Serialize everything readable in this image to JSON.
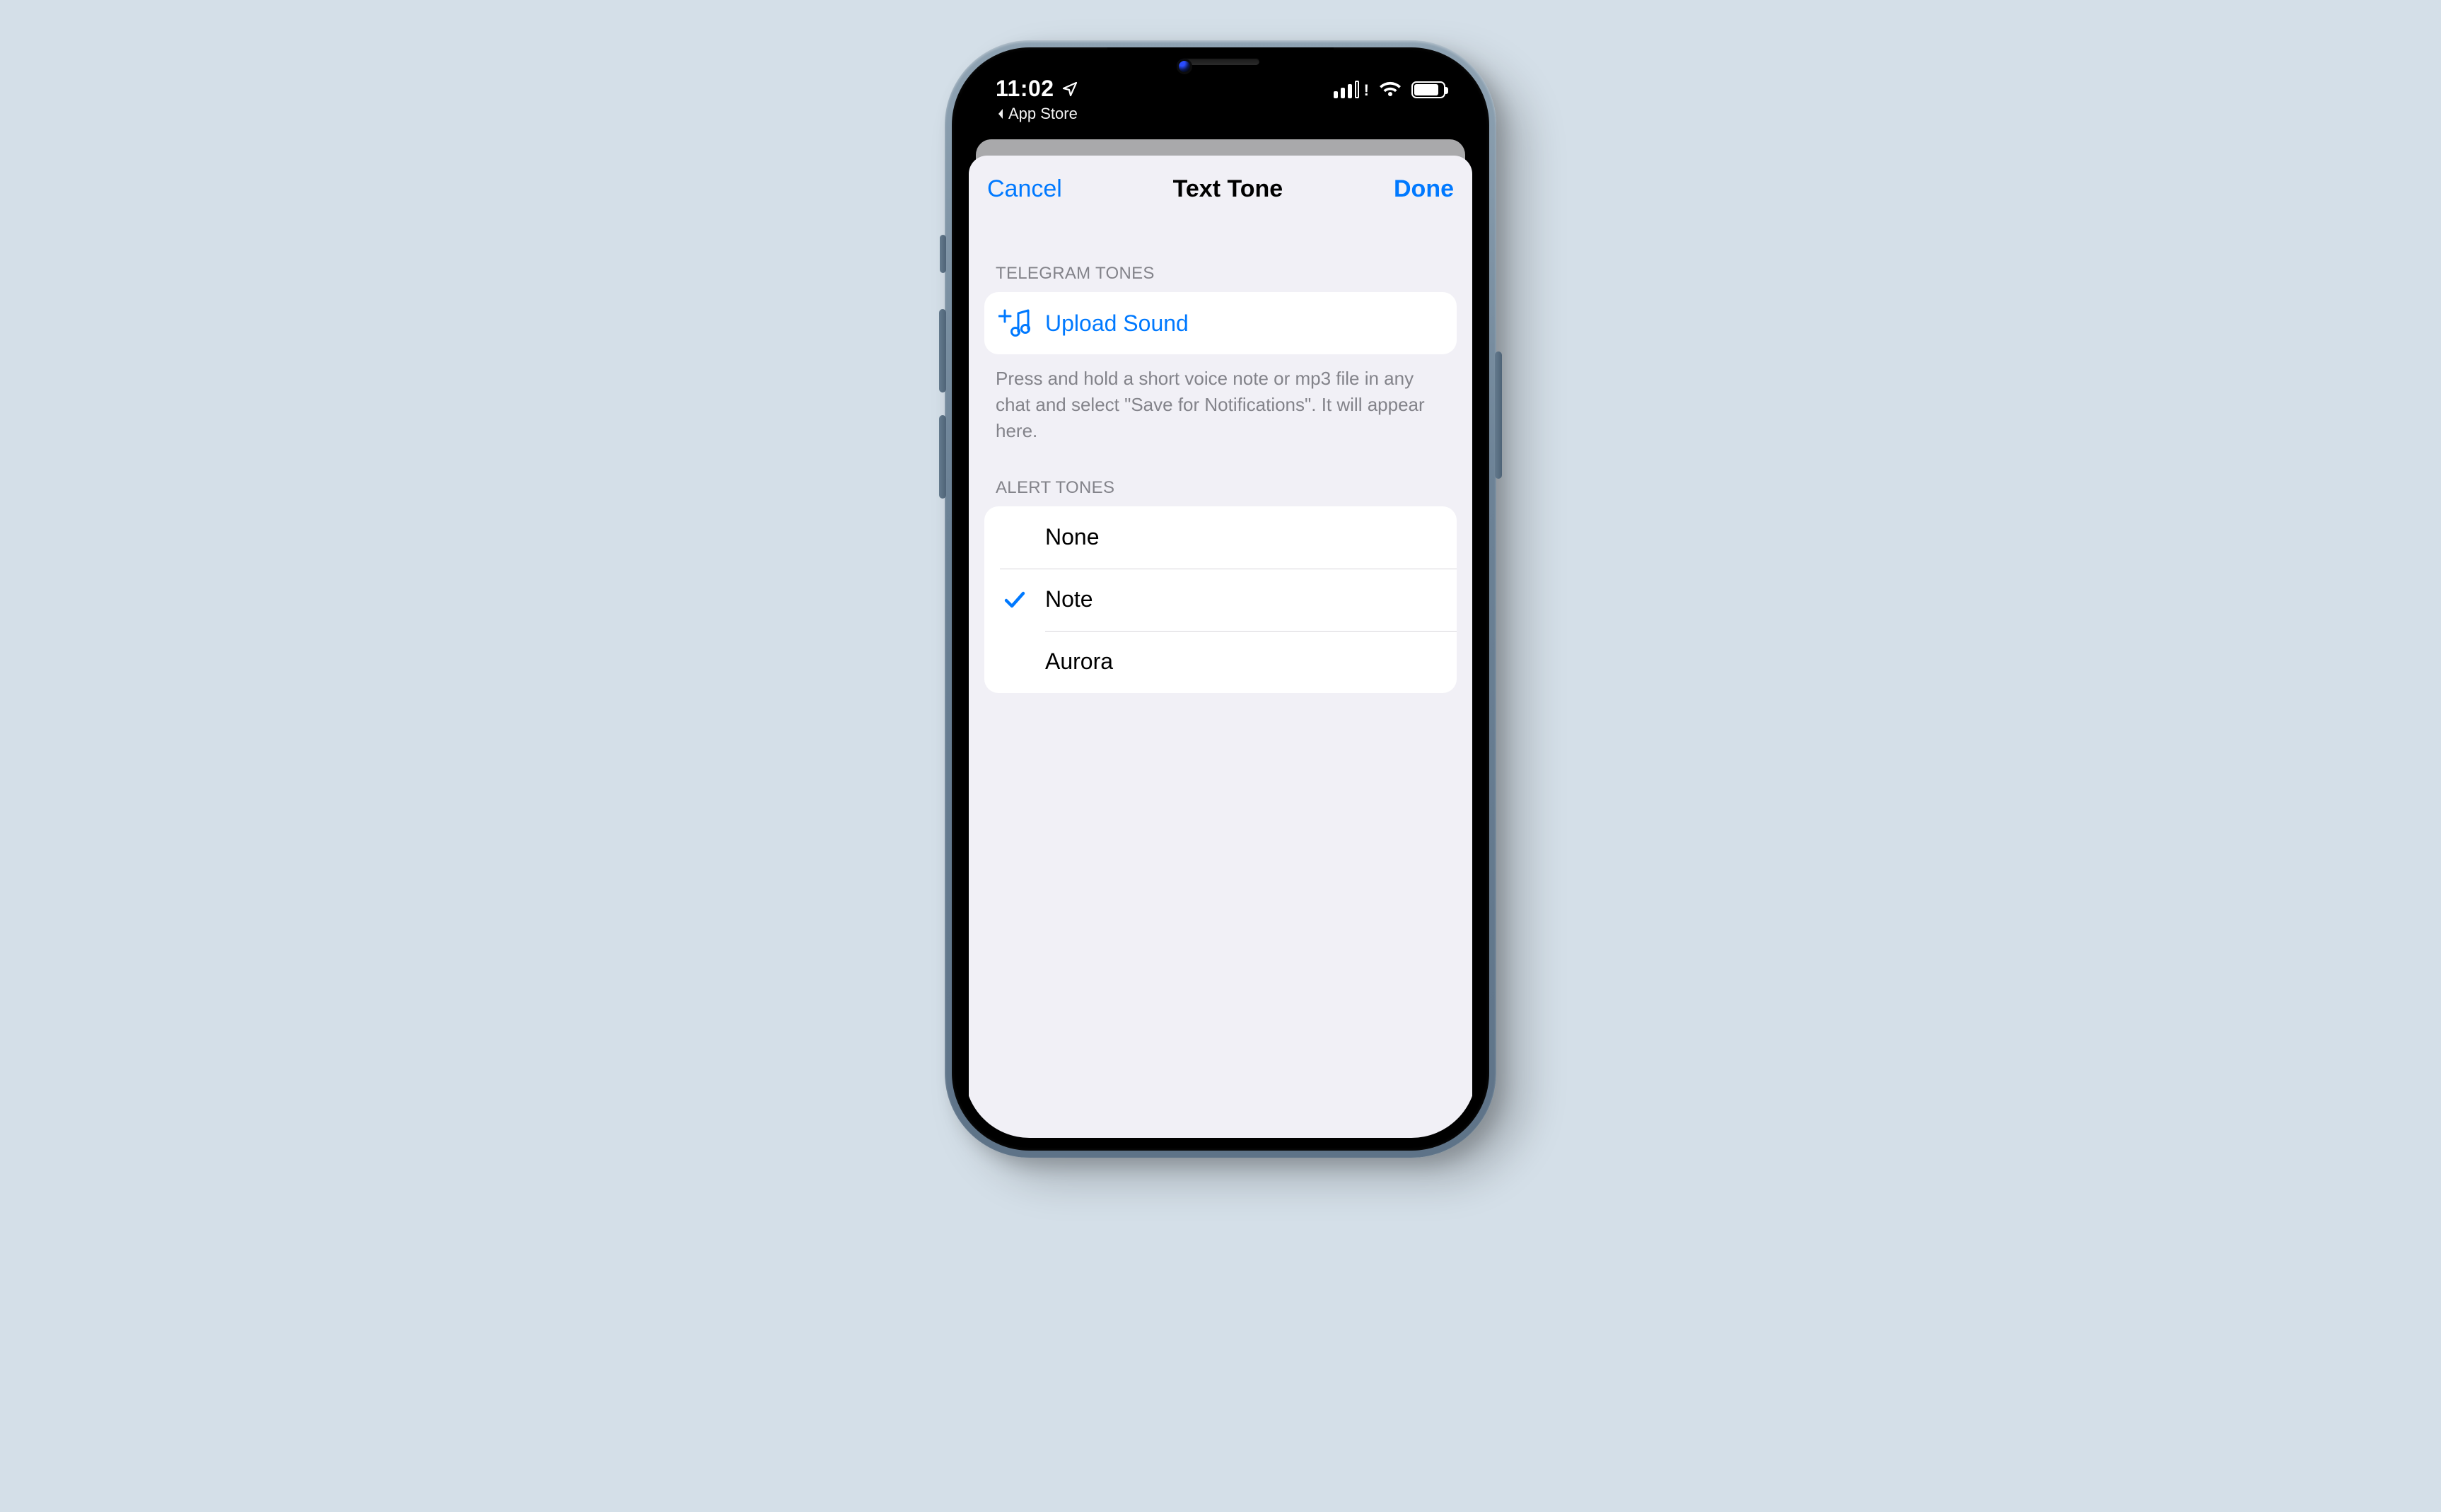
{
  "statusbar": {
    "time": "11:02",
    "back_app": "App Store"
  },
  "nav": {
    "cancel": "Cancel",
    "title": "Text Tone",
    "done": "Done"
  },
  "telegram_section": {
    "header": "TELEGRAM TONES",
    "upload_label": "Upload Sound",
    "footer": "Press and hold a short voice note or mp3 file in any chat and select \"Save for Notifications\". It will appear here."
  },
  "alert_section": {
    "header": "ALERT TONES",
    "items": [
      {
        "label": "None",
        "selected": false
      },
      {
        "label": "Note",
        "selected": true
      },
      {
        "label": "Aurora",
        "selected": false
      }
    ]
  },
  "colors": {
    "accent": "#0079ff"
  }
}
